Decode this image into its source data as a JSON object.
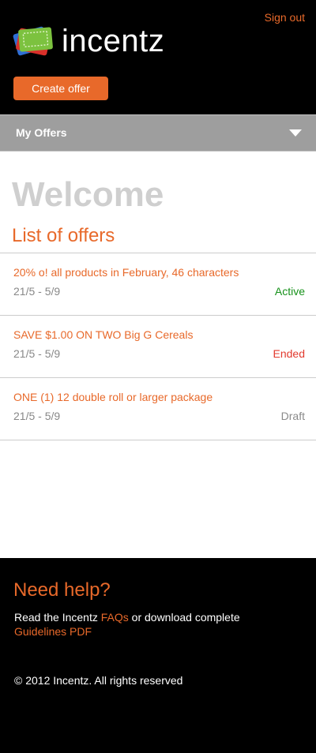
{
  "header": {
    "signout_label": "Sign out",
    "logo_text": "incentz",
    "create_offer_label": "Create offer"
  },
  "nav": {
    "my_offers_label": "My Offers",
    "dropdown_icon": "caret-down-icon"
  },
  "main": {
    "welcome": "Welcome",
    "list_title": "List of offers",
    "offers": [
      {
        "title": "20% o! all products in February, 46 characters",
        "dates": "21/5 - 5/9",
        "status": "Active",
        "status_color": "#16911a"
      },
      {
        "title": "SAVE $1.00 ON TWO Big G Cereals",
        "dates": "21/5 - 5/9",
        "status": "Ended",
        "status_color": "#e23a2e"
      },
      {
        "title": "ONE (1) 12 double roll or larger package",
        "dates": "21/5 - 5/9",
        "status": "Draft",
        "status_color": "#8a8a8a"
      }
    ]
  },
  "footer": {
    "help_title": "Need help?",
    "help_text_before": "Read the Incentz ",
    "faqs_link": "FAQs",
    "help_text_middle": " or download complete",
    "guidelines_link": "Guidelines PDF",
    "copyright": "© 2012 Incentz. All rights reserved"
  },
  "colors": {
    "accent": "#e8692a",
    "header_bg": "#000000",
    "nav_bg": "#9e9e9e"
  }
}
